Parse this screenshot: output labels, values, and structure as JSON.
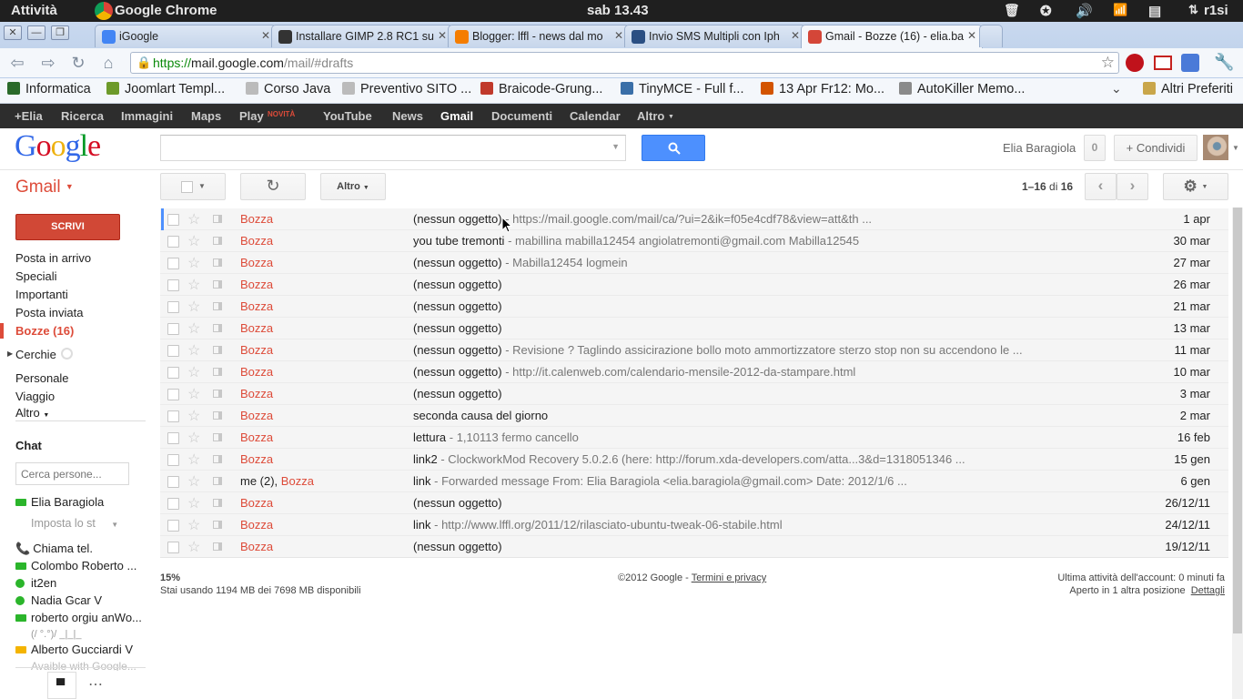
{
  "system": {
    "activities": "Attività",
    "app": "Google Chrome",
    "clock": "sab 13.43",
    "user": "r1si"
  },
  "tabs": [
    {
      "label": "iGoogle",
      "color": "#4285f4"
    },
    {
      "label": "Installare GIMP 2.8 RC1 su",
      "color": "#333333"
    },
    {
      "label": "Blogger: lffl - news dal mo",
      "color": "#f57d00"
    },
    {
      "label": "Invio SMS Multipli con Iph",
      "color": "#2b4f83"
    },
    {
      "label": "Gmail - Bozze (16) - elia.ba",
      "color": "#d44638"
    }
  ],
  "omnibox": {
    "scheme": "https://",
    "host": "mail.google.com",
    "path": "/mail/#drafts"
  },
  "bookmarks": [
    {
      "label": "Informatica",
      "color": "#2a6a2a"
    },
    {
      "label": "Joomlart Templ...",
      "color": "#6d9a2a"
    },
    {
      "label": "Corso Java",
      "color": "#bbbbbb"
    },
    {
      "label": "Preventivo SITO ...",
      "color": "#bbbbbb"
    },
    {
      "label": "Braicode-Grung...",
      "color": "#c0392b"
    },
    {
      "label": "TinyMCE - Full f...",
      "color": "#3a6fa8"
    },
    {
      "label": "13 Apr Fr12: Mo...",
      "color": "#d35400"
    },
    {
      "label": "AutoKiller Memo...",
      "color": "#8a8a8a"
    }
  ],
  "bookmarks_other": "Altri Preferiti",
  "gbar": [
    "+Elia",
    "Ricerca",
    "Immagini",
    "Maps",
    "Play",
    "YouTube",
    "News",
    "Gmail",
    "Documenti",
    "Calendar",
    "Altro"
  ],
  "gbar_new": "NOVITÀ",
  "header": {
    "logo": "Google",
    "account": "Elia Baragiola",
    "notif": "0",
    "share": "Condividi"
  },
  "gmail": {
    "title": "Gmail",
    "compose": "SCRIVI",
    "more": "Altro",
    "count": "1–16",
    "of": "di",
    "total": "16"
  },
  "nav": [
    "Posta in arrivo",
    "Speciali",
    "Importanti",
    "Posta inviata",
    "Bozze (16)",
    "Cerchie",
    "Personale",
    "Viaggio",
    "Altro"
  ],
  "rows": [
    {
      "sender": "Bozza",
      "me": "",
      "subject": "(nessun oggetto)",
      "snippet": " - https://mail.google.com/mail/ca/?ui=2&ik=f05e4cdf78&view=att&th ...",
      "date": "1 apr"
    },
    {
      "sender": "Bozza",
      "me": "",
      "subject": "you tube tremonti",
      "snippet": " - mabillina mabilla12454 angiolatremonti@gmail.com Mabilla12545",
      "date": "30 mar"
    },
    {
      "sender": "Bozza",
      "me": "",
      "subject": "(nessun oggetto)",
      "snippet": " - Mabilla12454 logmein",
      "date": "27 mar"
    },
    {
      "sender": "Bozza",
      "me": "",
      "subject": "(nessun oggetto)",
      "snippet": "",
      "date": "26 mar"
    },
    {
      "sender": "Bozza",
      "me": "",
      "subject": "(nessun oggetto)",
      "snippet": "",
      "date": "21 mar"
    },
    {
      "sender": "Bozza",
      "me": "",
      "subject": "(nessun oggetto)",
      "snippet": "",
      "date": "13 mar"
    },
    {
      "sender": "Bozza",
      "me": "",
      "subject": "(nessun oggetto)",
      "snippet": " - Revisione ? Taglindo assicirazione bollo moto ammortizzatore sterzo stop non su accendono le ...",
      "date": "11 mar"
    },
    {
      "sender": "Bozza",
      "me": "",
      "subject": "(nessun oggetto)",
      "snippet": " - http://it.calenweb.com/calendario-mensile-2012-da-stampare.html",
      "date": "10 mar"
    },
    {
      "sender": "Bozza",
      "me": "",
      "subject": "(nessun oggetto)",
      "snippet": "",
      "date": "3 mar"
    },
    {
      "sender": "Bozza",
      "me": "",
      "subject": "seconda causa del giorno",
      "snippet": "",
      "date": "2 mar"
    },
    {
      "sender": "Bozza",
      "me": "",
      "subject": "lettura",
      "snippet": " - 1,10113 fermo cancello",
      "date": "16 feb"
    },
    {
      "sender": "Bozza",
      "me": "",
      "subject": "link2",
      "snippet": " - ClockworkMod Recovery 5.0.2.6 (here: http://forum.xda-developers.com/atta...3&d=1318051346 ...",
      "date": "15 gen"
    },
    {
      "sender": "Bozza",
      "me": "me (2), ",
      "subject": "link",
      "snippet": " - Forwarded message From: Elia Baragiola <elia.baragiola@gmail.com> Date: 2012/1/6 ...",
      "date": "6 gen"
    },
    {
      "sender": "Bozza",
      "me": "",
      "subject": "(nessun oggetto)",
      "snippet": "",
      "date": "26/12/11"
    },
    {
      "sender": "Bozza",
      "me": "",
      "subject": "link",
      "snippet": " - http://www.lffl.org/2011/12/rilasciato-ubuntu-tweak-06-stabile.html",
      "date": "24/12/11"
    },
    {
      "sender": "Bozza",
      "me": "",
      "subject": "(nessun oggetto)",
      "snippet": "",
      "date": "19/12/11"
    }
  ],
  "footer": {
    "usage_pct": "15%",
    "usage": "Stai usando 1194 MB dei 7698 MB disponibili",
    "copy": "©2012 Google - ",
    "terms": "Termini e privacy",
    "activity": "Ultima attività dell'account: 0 minuti fa",
    "open": "Aperto in 1 altra posizione",
    "details": "Dettagli"
  },
  "chat": {
    "title": "Chat",
    "search_placeholder": "Cerca persone...",
    "self": "Elia Baragiola",
    "status": "Imposta lo st",
    "call": "Chiama tel.",
    "contacts": [
      {
        "name": "Colombo Roberto ...",
        "kind": "cam",
        "color": "#2bb52b"
      },
      {
        "name": "it2en",
        "kind": "dot",
        "color": "#2bb52b"
      },
      {
        "name": "Nadia Gcar V",
        "kind": "dot",
        "color": "#2bb52b"
      },
      {
        "name": "roberto orgiu anWo...",
        "kind": "cam",
        "color": "#2bb52b"
      },
      {
        "name": "Alberto Gucciardi V",
        "kind": "cam",
        "color": "#f4b400"
      }
    ],
    "status_line": "(/ °.°)/ _|_|_",
    "avail": "Avaible with Google..."
  }
}
